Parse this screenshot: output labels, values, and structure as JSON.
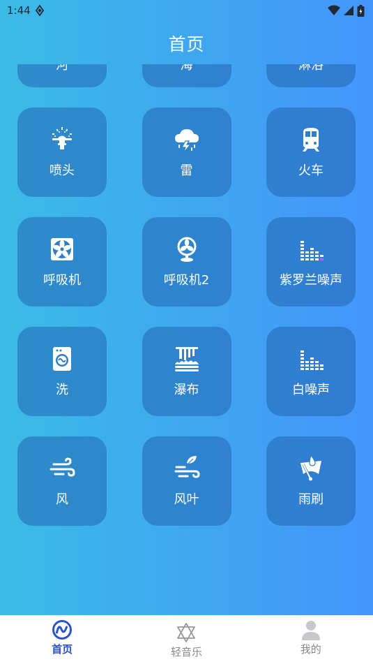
{
  "status_bar": {
    "time": "1:44"
  },
  "header": {
    "title": "首页"
  },
  "sounds": [
    {
      "label": "河",
      "icon": "river-icon"
    },
    {
      "label": "海",
      "icon": "sea-icon"
    },
    {
      "label": "淋浴",
      "icon": "shower-icon"
    },
    {
      "label": "喷头",
      "icon": "sprinkler-icon"
    },
    {
      "label": "雷",
      "icon": "thunder-icon"
    },
    {
      "label": "火车",
      "icon": "train-icon"
    },
    {
      "label": "呼吸机",
      "icon": "fan-box-icon"
    },
    {
      "label": "呼吸机2",
      "icon": "desk-fan-icon"
    },
    {
      "label": "紫罗兰噪声",
      "icon": "equalizer-icon"
    },
    {
      "label": "洗",
      "icon": "washing-machine-icon"
    },
    {
      "label": "瀑布",
      "icon": "waterfall-icon"
    },
    {
      "label": "白噪声",
      "icon": "equalizer-icon"
    },
    {
      "label": "风",
      "icon": "wind-icon"
    },
    {
      "label": "风叶",
      "icon": "wind-leaf-icon"
    },
    {
      "label": "雨刷",
      "icon": "wiper-icon"
    }
  ],
  "bottom_nav": [
    {
      "label": "首页",
      "icon": "home-wave-icon",
      "active": true
    },
    {
      "label": "轻音乐",
      "icon": "star-of-david-icon",
      "active": false
    },
    {
      "label": "我的",
      "icon": "user-icon",
      "active": false
    }
  ],
  "colors": {
    "active": "#2a52c9",
    "inactive": "#888888",
    "tile": "#2d7fc4"
  }
}
